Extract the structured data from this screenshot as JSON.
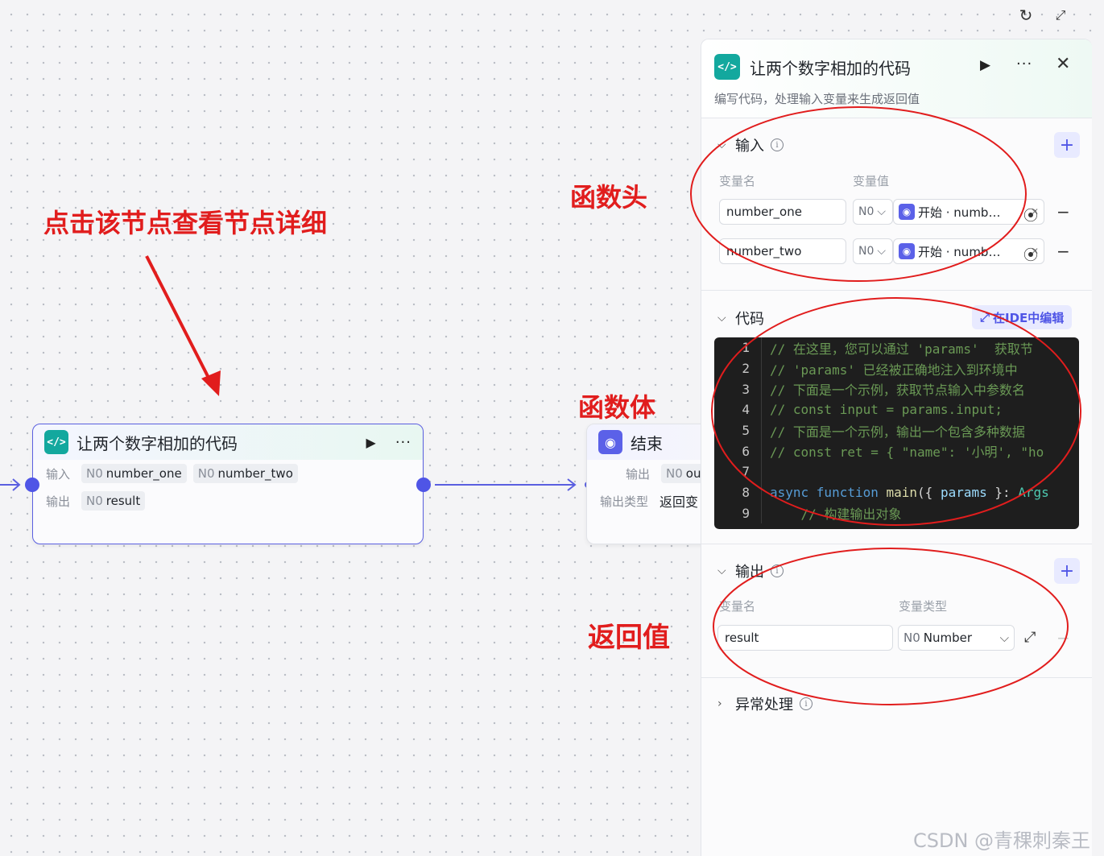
{
  "annotations": {
    "click_hint": "点击该节点查看节点详细",
    "func_head": "函数头",
    "func_body": "函数体",
    "return_value": "返回值",
    "watermark": "CSDN @青稞刺秦王"
  },
  "colors": {
    "accent": "#4f55e6",
    "code_icon": "#13a89e",
    "annotation": "#e11d1d"
  },
  "code_node": {
    "icon": "</>",
    "title": "让两个数字相加的代码",
    "input_label": "输入",
    "output_label": "输出",
    "inputs": [
      {
        "type": "N0",
        "name": "number_one"
      },
      {
        "type": "N0",
        "name": "number_two"
      }
    ],
    "outputs": [
      {
        "type": "N0",
        "name": "result"
      }
    ]
  },
  "end_node": {
    "title": "结束",
    "output_label": "输出",
    "output_tag_type": "N0",
    "output_tag_name": "ou",
    "output_type_label": "输出类型",
    "output_type_value": "返回变"
  },
  "panel": {
    "title": "让两个数字相加的代码",
    "subtitle": "编写代码，处理输入变量来生成返回值",
    "input_section": {
      "title": "输入",
      "col_name": "变量名",
      "col_value": "变量值",
      "rows": [
        {
          "name": "number_one",
          "type": "N0",
          "ref": "开始 · numb…"
        },
        {
          "name": "number_two",
          "type": "N0",
          "ref": "开始 · numb…"
        }
      ]
    },
    "code_section": {
      "title": "代码",
      "ide_button": "在IDE中编辑",
      "line_numbers": [
        "1",
        "2",
        "3",
        "4",
        "5",
        "6",
        "7",
        "8",
        "9"
      ]
    },
    "output_section": {
      "title": "输出",
      "col_name": "变量名",
      "col_type": "变量类型",
      "rows": [
        {
          "name": "result",
          "type_prefix": "N0",
          "type": "Number"
        }
      ]
    },
    "exception_section": {
      "title": "异常处理"
    }
  }
}
